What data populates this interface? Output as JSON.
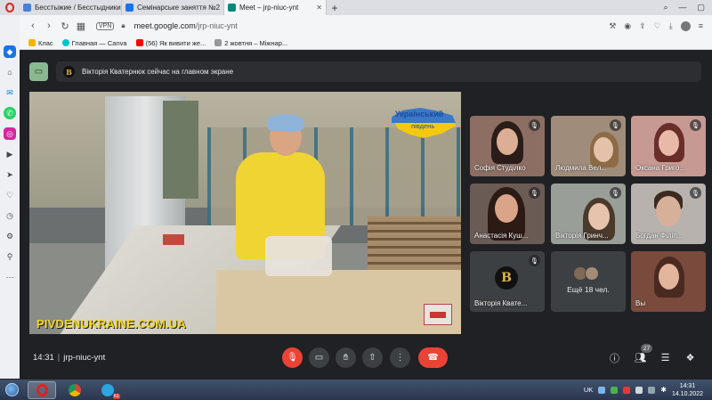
{
  "tabs": [
    {
      "title": "Бесстыжие / Бесстыдники",
      "color": "#4a7fd6",
      "active": false
    },
    {
      "title": "Семінарське заняття №2 ",
      "color": "#1a73e8",
      "active": false
    },
    {
      "title": "Meet – jrp-niuc-ynt",
      "color": "#00897b",
      "active": true
    }
  ],
  "address": {
    "vpn": "VPN",
    "url_host": "meet.google.com",
    "url_path": "/jrp-niuc-ynt"
  },
  "bookmarks": [
    {
      "label": "Клас",
      "color": "#f4b400"
    },
    {
      "label": "Главная — Canva",
      "color": "#00c4cc"
    },
    {
      "label": "(56) Як вивити же...",
      "color": "#ff0000"
    },
    {
      "label": "2 жовтня – Міжнар...",
      "color": "#999999"
    }
  ],
  "meet": {
    "notice": "Вікторія Кватернюк сейчас на главном экране",
    "presenter_initial": "B",
    "video": {
      "watermark": "PIVDENUKRAINE.COM.UA",
      "logo_line1": "Український",
      "logo_line2": "південь"
    },
    "participants": [
      {
        "name": "Софія Студілко",
        "muted": true
      },
      {
        "name": "Людмила Вел...",
        "muted": true
      },
      {
        "name": "Оксана Григо...",
        "muted": true
      },
      {
        "name": "Анастасія Куш...",
        "muted": true
      },
      {
        "name": "Вікторія Гринч...",
        "muted": true
      },
      {
        "name": "Богдан Філіп...",
        "muted": true
      },
      {
        "name": "Вікторія Квате...",
        "muted": true,
        "initial": "B"
      },
      {
        "name": "Ещё 18 чел.",
        "muted": false
      },
      {
        "name": "Вы",
        "muted": false
      }
    ],
    "footer": {
      "time": "14:31",
      "separator": "|",
      "meeting_code": "jrp-niuc-ynt",
      "people_count": "27"
    }
  },
  "taskbar": {
    "lang": "UK",
    "time": "14:31",
    "date": "14.10.2022",
    "telegram_badge": "61"
  }
}
